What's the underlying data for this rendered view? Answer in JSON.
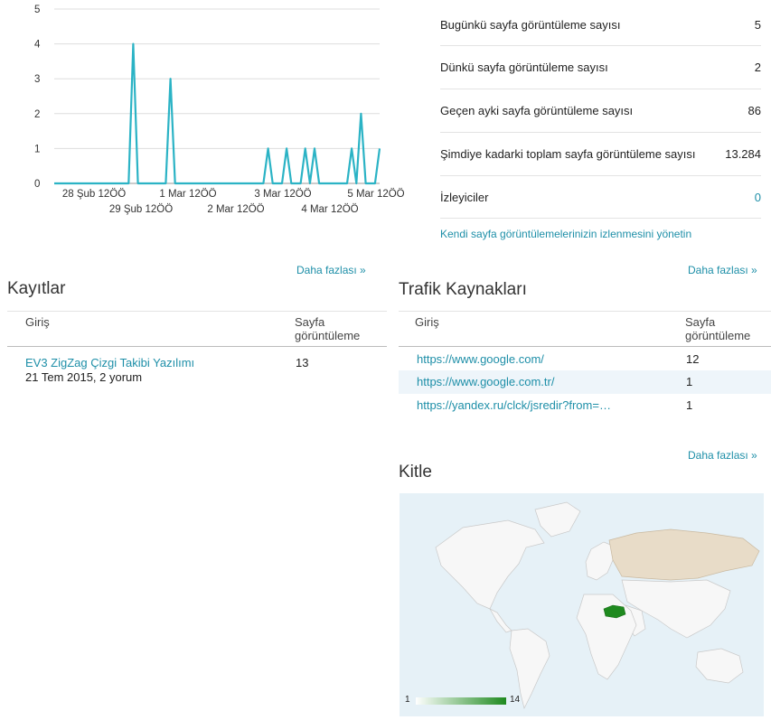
{
  "chart_data": {
    "type": "line",
    "y_ticks": [
      "0",
      "1",
      "2",
      "3",
      "4",
      "5"
    ],
    "ylim": [
      0,
      5
    ],
    "x_ticks_top": [
      "28 Şub 12ÖÖ",
      "1 Mar 12ÖÖ",
      "3 Mar 12ÖÖ",
      "5 Mar 12ÖÖ"
    ],
    "x_ticks_bottom": [
      "29 Şub 12ÖÖ",
      "2 Mar 12ÖÖ",
      "4 Mar 12ÖÖ"
    ],
    "color": "#2bb3c5",
    "series": [
      {
        "values": [
          0,
          0,
          0,
          0,
          0,
          0,
          0,
          0,
          0,
          0,
          0,
          0,
          0,
          0,
          0,
          0,
          0,
          4,
          0,
          0,
          0,
          0,
          0,
          0,
          0,
          3,
          0,
          0,
          0,
          0,
          0,
          0,
          0,
          0,
          0,
          0,
          0,
          0,
          0,
          0,
          0,
          0,
          0,
          0,
          0,
          0,
          1,
          0,
          0,
          0,
          1,
          0,
          0,
          0,
          1,
          0,
          1,
          0,
          0,
          0,
          0,
          0,
          0,
          0,
          1,
          0,
          2,
          0,
          0,
          0,
          1
        ]
      }
    ]
  },
  "stats": [
    {
      "label": "Bugünkü sayfa görüntüleme sayısı",
      "value": "5"
    },
    {
      "label": "Dünkü sayfa görüntüleme sayısı",
      "value": "2"
    },
    {
      "label": "Geçen ayki sayfa görüntüleme sayısı",
      "value": "86"
    },
    {
      "label": "Şimdiye kadarki toplam sayfa görüntüleme sayısı",
      "value": "13.284"
    },
    {
      "label": "İzleyiciler",
      "value": "0"
    }
  ],
  "manage_link": "Kendi sayfa görüntülemelerinizin izlenmesini yönetin",
  "posts": {
    "title": "Kayıtlar",
    "more": "Daha fazlası »",
    "col_entry": "Giriş",
    "col_views": "Sayfa görüntüleme",
    "rows": [
      {
        "title": "EV3 ZigZag Çizgi Takibi Yazılımı",
        "meta": "21 Tem 2015, 2 yorum",
        "views": "13"
      }
    ]
  },
  "traffic": {
    "title": "Trafik Kaynakları",
    "more": "Daha fazlası »",
    "col_entry": "Giriş",
    "col_views": "Sayfa görüntüleme",
    "rows": [
      {
        "url": "https://www.google.com/",
        "views": "12"
      },
      {
        "url": "https://www.google.com.tr/",
        "views": "1"
      },
      {
        "url": "https://yandex.ru/clck/jsredir?from=…",
        "views": "1"
      }
    ]
  },
  "audience": {
    "title": "Kitle",
    "more": "Daha fazlası »",
    "legend_min": "1",
    "legend_max": "14",
    "highlight_color": "#1f8a1f",
    "secondary_color": "#e8dcc8"
  }
}
